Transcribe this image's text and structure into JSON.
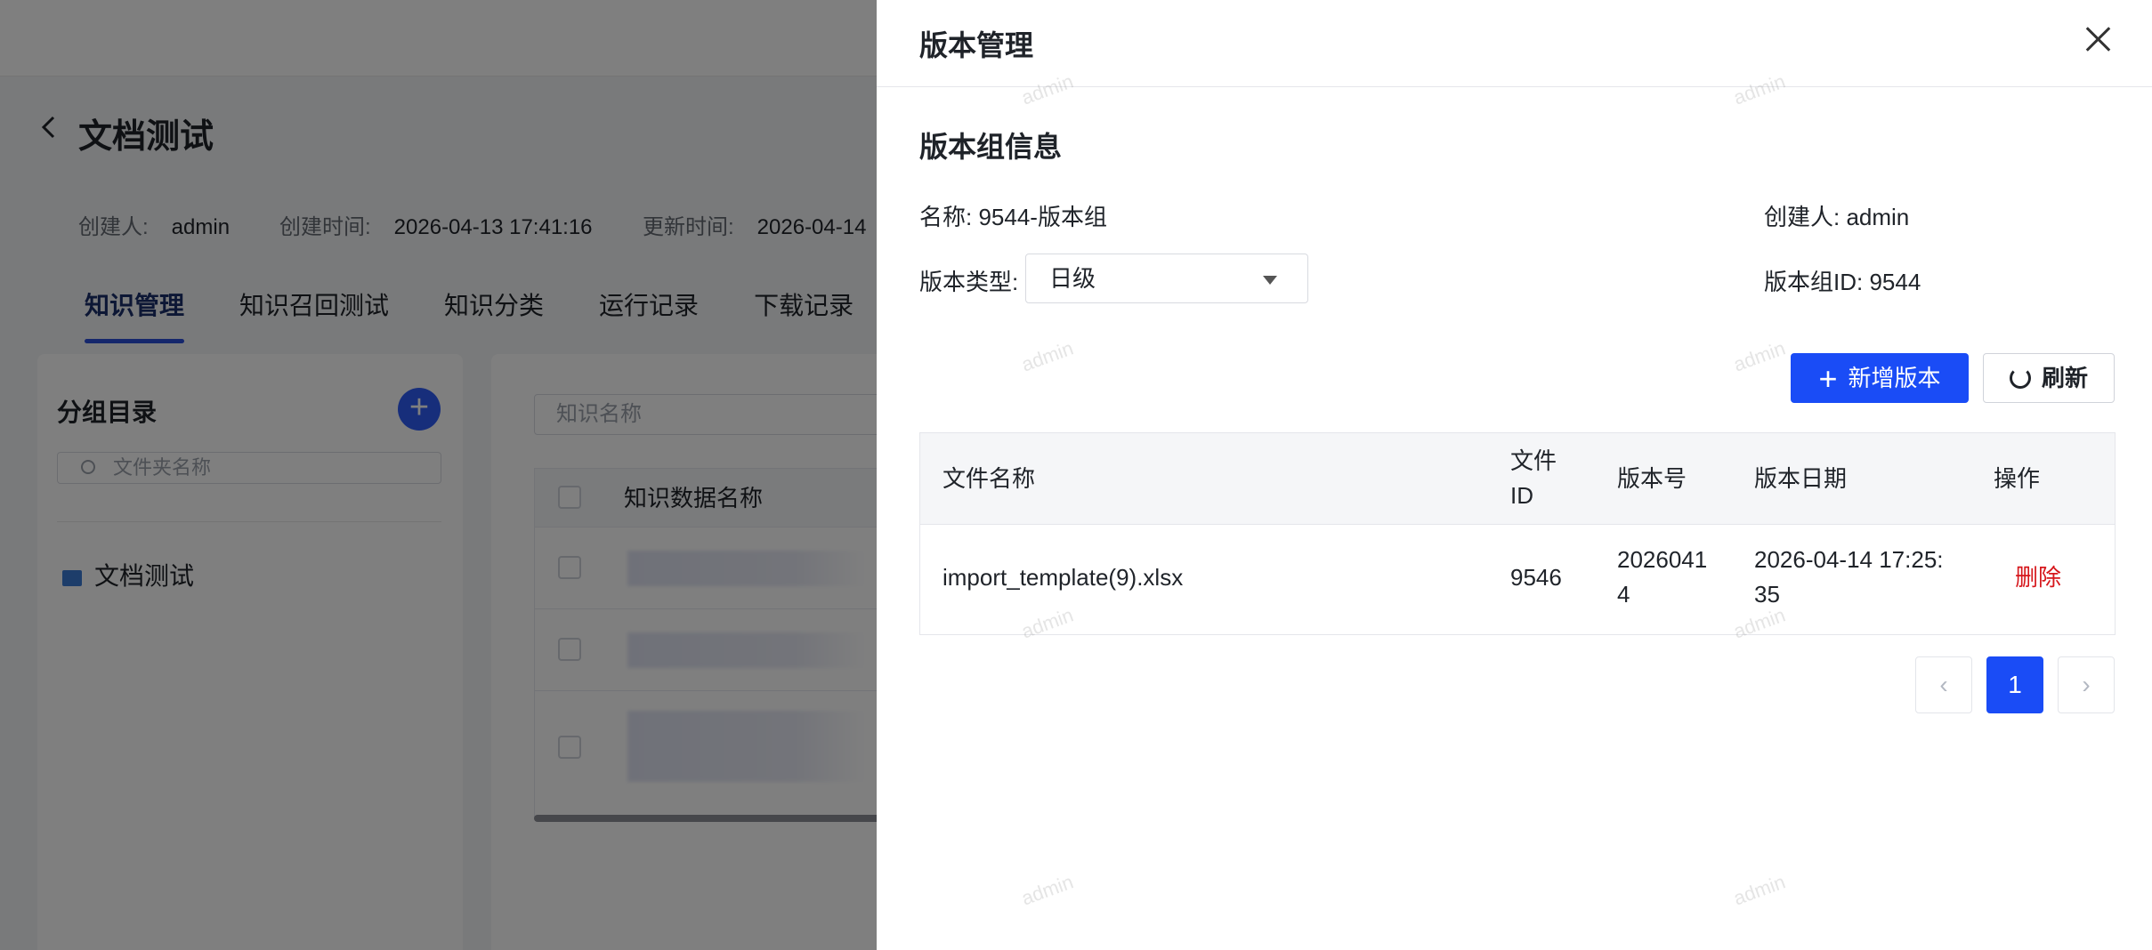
{
  "background": {
    "page_title": "文档测试",
    "meta": {
      "creator_label": "创建人:",
      "creator": "admin",
      "created_label": "创建时间:",
      "created": "2026-04-13 17:41:16",
      "updated_label": "更新时间:",
      "updated": "2026-04-14"
    },
    "tabs": [
      "知识管理",
      "知识召回测试",
      "知识分类",
      "运行记录",
      "下载记录"
    ],
    "sidebar": {
      "title": "分组目录",
      "search_placeholder": "文件夹名称",
      "folder": "文档测试"
    },
    "main": {
      "search_placeholder": "知识名称",
      "column_name": "知识数据名称"
    }
  },
  "drawer": {
    "title": "版本管理",
    "section_title": "版本组信息",
    "name_label": "名称: 9544-版本组",
    "creator_label": "创建人: admin",
    "type_label": "版本类型:",
    "type_value": "日级",
    "group_id_label": "版本组ID: 9544",
    "add_button": "新增版本",
    "refresh_button": "刷新",
    "table": {
      "headers": {
        "file_name": "文件名称",
        "file_id_1": "文件",
        "file_id_2": "ID",
        "version_no": "版本号",
        "version_date": "版本日期",
        "action": "操作"
      },
      "rows": [
        {
          "file_name": "import_template(9).xlsx",
          "file_id": "9546",
          "version_no_1": "2026041",
          "version_no_2": "4",
          "version_date_1": "2026-04-14 17:25:",
          "version_date_2": "35",
          "action": "删除"
        }
      ]
    },
    "pagination": {
      "prev": "‹",
      "current": "1",
      "next": "›"
    }
  },
  "watermark": "admin",
  "colors": {
    "primary": "#1a4cf6",
    "danger": "#d6161b"
  }
}
